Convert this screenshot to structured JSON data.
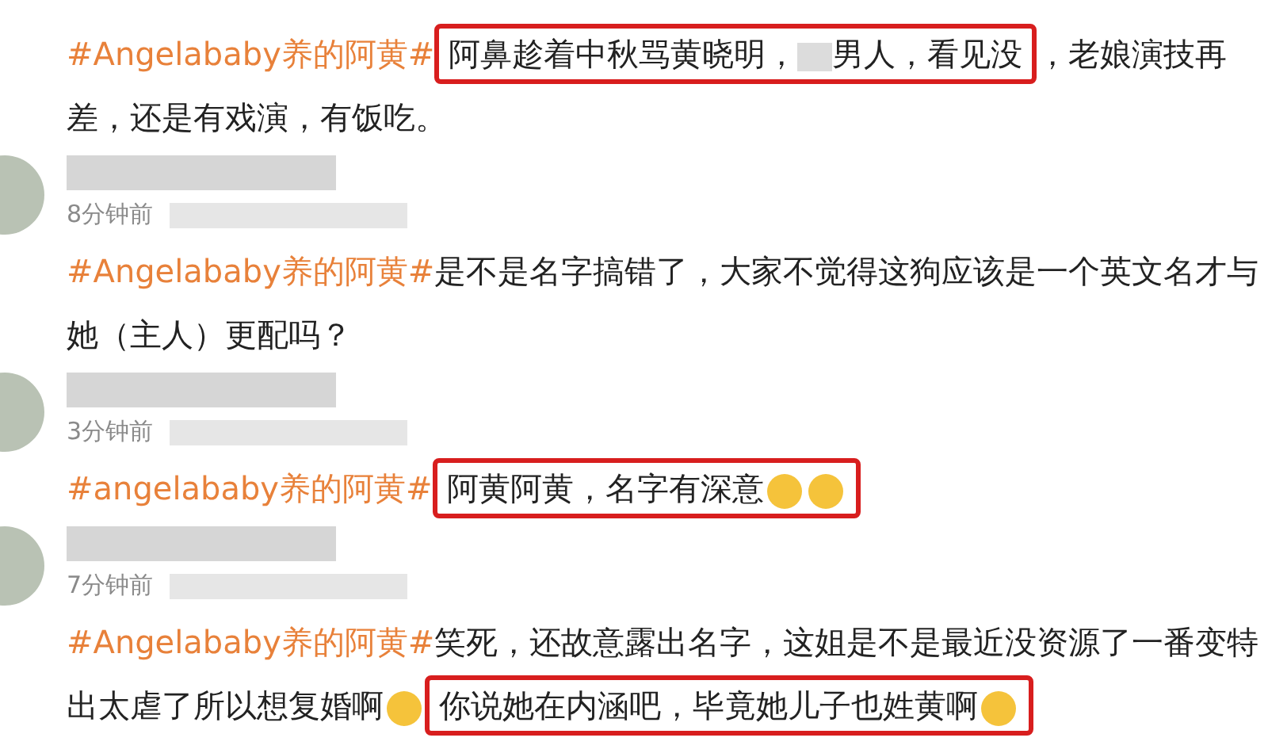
{
  "comments": [
    {
      "kind": "tail",
      "segments": [
        {
          "kind": "tag",
          "text": "#Angelababy养的阿黄#"
        },
        {
          "kind": "highlight",
          "children": [
            {
              "kind": "text",
              "text": "阿鼻趁着中秋骂黄晓明，"
            },
            {
              "kind": "blur"
            },
            {
              "kind": "text",
              "text": "男人，看见没"
            }
          ]
        },
        {
          "kind": "text",
          "text": "，老娘演技再差，还是有戏演，有饭吃。"
        }
      ]
    },
    {
      "kind": "full",
      "time": "8分钟前",
      "segments": [
        {
          "kind": "tag",
          "text": "#Angelababy养的阿黄#"
        },
        {
          "kind": "text",
          "text": "是不是名字搞错了，大家不觉得这狗应该是一个英文名才与她（主人）更配吗？"
        }
      ]
    },
    {
      "kind": "full",
      "time": "3分钟前",
      "segments": [
        {
          "kind": "tag",
          "text": "#angelababy养的阿黄#"
        },
        {
          "kind": "highlight",
          "children": [
            {
              "kind": "text",
              "text": "阿黄阿黄，名字有深意"
            },
            {
              "kind": "emoji"
            },
            {
              "kind": "emoji"
            }
          ]
        }
      ]
    },
    {
      "kind": "full",
      "time": "7分钟前",
      "segments": [
        {
          "kind": "tag",
          "text": "#Angelababy养的阿黄#"
        },
        {
          "kind": "text",
          "text": "笑死，还故意露出名字，这姐是不是最近没资源了一番变特出太虐了所以想复婚啊"
        },
        {
          "kind": "emoji"
        },
        {
          "kind": "highlight",
          "children": [
            {
              "kind": "text",
              "text": "你说她在内涵吧，毕竟她儿子也姓黄啊"
            },
            {
              "kind": "emoji"
            }
          ]
        }
      ]
    }
  ]
}
